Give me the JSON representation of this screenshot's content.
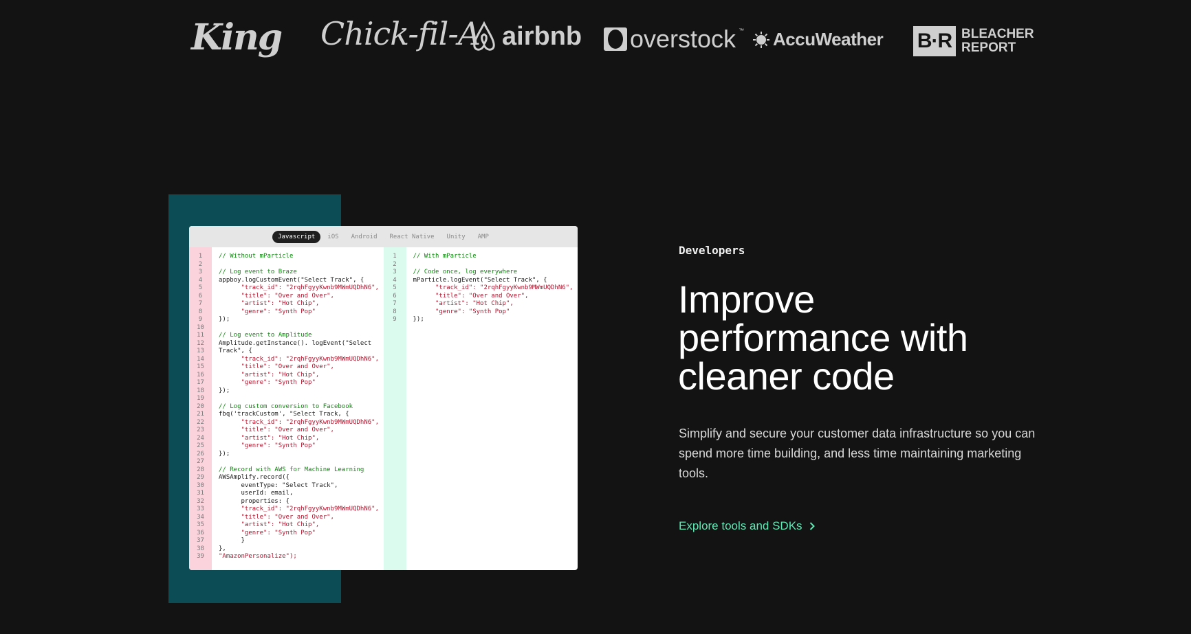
{
  "logos": {
    "king": "King",
    "chickfila": "Chick-fil-A",
    "airbnb": "airbnb",
    "overstock": "overstock",
    "overstock_tm": "™",
    "accuweather": "AccuWeather",
    "bleacher_mark": "B·R",
    "bleacher_line1": "BLEACHER",
    "bleacher_line2": "REPORT"
  },
  "code_window": {
    "tabs": [
      "Javascript",
      "iOS",
      "Android",
      "React Native",
      "Unity",
      "AMP"
    ],
    "active_tab": "Javascript",
    "left_line_numbers": "1\n2\n3\n4\n5\n6\n7\n8\n9\n10\n11\n12\n13\n14\n15\n16\n17\n18\n19\n20\n21\n22\n23\n24\n25\n26\n27\n28\n29\n30\n31\n32\n33\n34\n35\n36\n37\n38\n39",
    "right_line_numbers": "1\n2\n3\n4\n5\n6\n7\n8\n9",
    "left_code": [
      {
        "t": "// Without mParticle",
        "k": "c"
      },
      {
        "t": "",
        "k": ""
      },
      {
        "t": "// Log event to Braze",
        "k": "c"
      },
      {
        "t": "appboy.logCustomEvent(\"Select Track\", {",
        "k": ""
      },
      {
        "t": "      \"track_id\": \"2rqhFgyyKwnb9MWmUQDhN6\",",
        "k": "s"
      },
      {
        "t": "      \"title\": \"Over and Over\",",
        "k": "s"
      },
      {
        "t": "      \"artist\": \"Hot Chip\",",
        "k": "s"
      },
      {
        "t": "      \"genre\": \"Synth Pop\"",
        "k": "s"
      },
      {
        "t": "});",
        "k": ""
      },
      {
        "t": "",
        "k": ""
      },
      {
        "t": "// Log event to Amplitude",
        "k": "c"
      },
      {
        "t": "Amplitude.getInstance(). logEvent(\"Select",
        "k": ""
      },
      {
        "t": "Track\", {",
        "k": ""
      },
      {
        "t": "      \"track_id\": \"2rqhFgyyKwnb9MWmUQDhN6\",",
        "k": "s"
      },
      {
        "t": "      \"title\": \"Over and Over\",",
        "k": "s"
      },
      {
        "t": "      \"artist\": \"Hot Chip\",",
        "k": "s"
      },
      {
        "t": "      \"genre\": \"Synth Pop\"",
        "k": "s"
      },
      {
        "t": "});",
        "k": ""
      },
      {
        "t": "",
        "k": ""
      },
      {
        "t": "// Log custom conversion to Facebook",
        "k": "c"
      },
      {
        "t": "fbq('trackCustom', \"Select Track, {",
        "k": ""
      },
      {
        "t": "      \"track_id\": \"2rqhFgyyKwnb9MWmUQDhN6\",",
        "k": "s"
      },
      {
        "t": "      \"title\": \"Over and Over\",",
        "k": "s"
      },
      {
        "t": "      \"artist\": \"Hot Chip\",",
        "k": "s"
      },
      {
        "t": "      \"genre\": \"Synth Pop\"",
        "k": "s"
      },
      {
        "t": "});",
        "k": ""
      },
      {
        "t": "",
        "k": ""
      },
      {
        "t": "// Record with AWS for Machine Learning",
        "k": "c"
      },
      {
        "t": "AWSAmplify.record({",
        "k": ""
      },
      {
        "t": "      eventType: \"Select Track\",",
        "k": ""
      },
      {
        "t": "      userId: email,",
        "k": ""
      },
      {
        "t": "      properties: {",
        "k": ""
      },
      {
        "t": "      \"track_id\": \"2rqhFgyyKwnb9MWmUQDhN6\",",
        "k": "s"
      },
      {
        "t": "      \"title\": \"Over and Over\",",
        "k": "s"
      },
      {
        "t": "      \"artist\": \"Hot Chip\",",
        "k": "s"
      },
      {
        "t": "      \"genre\": \"Synth Pop\"",
        "k": "s"
      },
      {
        "t": "      }",
        "k": ""
      },
      {
        "t": "},",
        "k": ""
      },
      {
        "t": "\"AmazonPersonalize\");",
        "k": "s"
      }
    ],
    "right_code": [
      {
        "t": "// With mParticle",
        "k": "c"
      },
      {
        "t": "",
        "k": ""
      },
      {
        "t": "// Code once, log everywhere",
        "k": "c"
      },
      {
        "t": "mParticle.logEvent(\"Select Track\", {",
        "k": ""
      },
      {
        "t": "      \"track_id\": \"2rqhFgyyKwnb9MWmUQDhN6\",",
        "k": "s"
      },
      {
        "t": "      \"title\": \"Over and Over\",",
        "k": "s"
      },
      {
        "t": "      \"artist\": \"Hot Chip\",",
        "k": "s"
      },
      {
        "t": "      \"genre\": \"Synth Pop\"",
        "k": "s"
      },
      {
        "t": "});",
        "k": ""
      }
    ]
  },
  "section": {
    "eyebrow": "Developers",
    "headline": "Improve performance with cleaner code",
    "body": "Simplify and secure your customer data infrastructure so you can spend more time building, and less time maintaining marketing tools.",
    "cta_label": "Explore tools and SDKs"
  },
  "colors": {
    "background": "#131313",
    "teal_block": "#0c4d55",
    "cta": "#5ee9b5",
    "code_comment": "#0a8a0a",
    "code_string": "#b3132b"
  }
}
